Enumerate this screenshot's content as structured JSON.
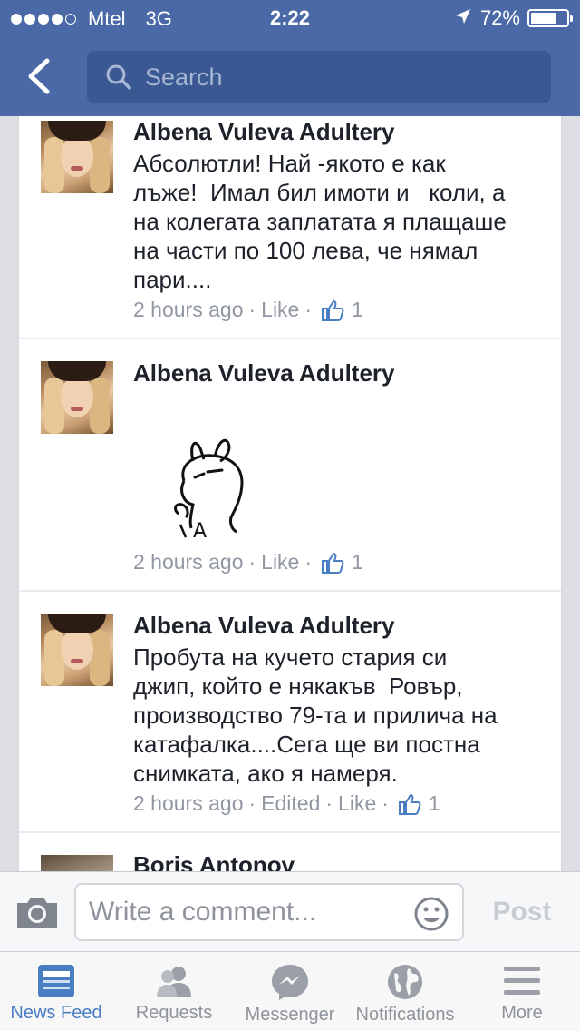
{
  "status_bar": {
    "carrier": "Mtel",
    "network": "3G",
    "time": "2:22",
    "battery_percent_text": "72%",
    "battery_level": 0.72,
    "signal_bars": 4,
    "signal_max": 5
  },
  "header": {
    "search_placeholder": "Search",
    "color": "#4a69a6"
  },
  "comments": [
    {
      "author": "Albena Vuleva Adultery",
      "text": "Абсолютли! Най -якото е как\nлъже!  Имал бил имоти и   коли, а\nна колегата заплатата я плащаше\nна части по 100 лева, че нямал\nпари....",
      "time": "2 hours ago",
      "edited": "",
      "like_label": "Like",
      "likes": "1"
    },
    {
      "author": "Albena Vuleva Adultery",
      "text": "",
      "sticker": "bunny-sticker",
      "time": "2 hours ago",
      "edited": "",
      "like_label": "Like",
      "likes": "1"
    },
    {
      "author": "Albena Vuleva Adultery",
      "text": "Пробута на кучето стария си\nджип, който е някакъв  Ровър,\nпроизводство 79-та и прилича на\nкатафалка....Сега ще ви постна\nснимката, ако я намеря.",
      "time": "2 hours ago",
      "edited": "Edited",
      "like_label": "Like",
      "likes": "1"
    },
    {
      "author": "Boris Antonov"
    }
  ],
  "meta_separator": "·",
  "comment_bar": {
    "placeholder": "Write a comment...",
    "post_label": "Post"
  },
  "tabs": [
    {
      "label": "News Feed",
      "icon": "news-feed-icon",
      "active": true
    },
    {
      "label": "Requests",
      "icon": "requests-icon",
      "active": false
    },
    {
      "label": "Messenger",
      "icon": "messenger-icon",
      "active": false
    },
    {
      "label": "Notifications",
      "icon": "notifications-icon",
      "active": false
    },
    {
      "label": "More",
      "icon": "more-icon",
      "active": false
    }
  ],
  "colors": {
    "brand": "#4a69a6",
    "active_tab": "#4a7ec3",
    "thumb": "#4a7ec3"
  }
}
